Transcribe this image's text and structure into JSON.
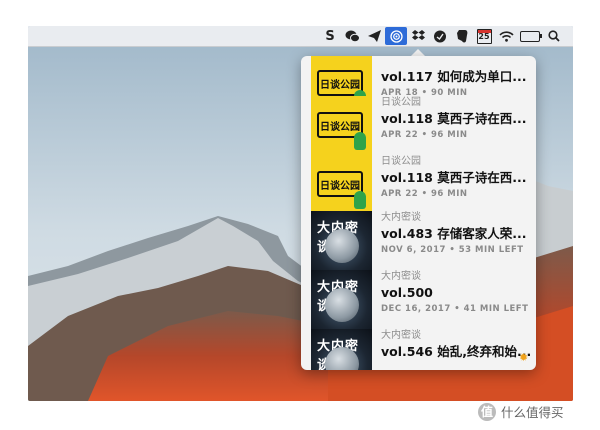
{
  "menubar": {
    "icons": [
      "s-icon",
      "wechat-icon",
      "telegram-icon",
      "podcast-icon",
      "dropbox-icon",
      "shield-icon",
      "evernote-icon",
      "calendar-icon",
      "wifi-icon",
      "battery-icon",
      "spotlight-icon"
    ],
    "s_glyph": "S",
    "calendar_day": "25"
  },
  "popup": {
    "episodes": [
      {
        "show": "",
        "title": "vol.117 如何成为单口...",
        "meta": "APR 18 • 90 MIN",
        "thumb": "yellow",
        "thumb_label": "日谈公园"
      },
      {
        "show": "日谈公园",
        "title": "vol.118 莫西子诗在西...",
        "meta": "APR 22 • 96 MIN",
        "thumb": "yellow",
        "thumb_label": "日谈公园"
      },
      {
        "show": "日谈公园",
        "title": "vol.118 莫西子诗在西...",
        "meta": "APR 22 • 96 MIN",
        "thumb": "yellow",
        "thumb_label": "日谈公园"
      },
      {
        "show": "大内密谈",
        "title": "vol.483 存储客家人荣...",
        "meta": "NOV 6, 2017 • 53 MIN LEFT",
        "thumb": "dark",
        "thumb_label": "大内密谈"
      },
      {
        "show": "大内密谈",
        "title": "vol.500",
        "meta": "DEC 16, 2017 • 41 MIN LEFT",
        "thumb": "dark",
        "thumb_label": "大内密谈"
      },
      {
        "show": "大内密谈",
        "title": "vol.546 始乱,终弃和始...",
        "meta": "",
        "thumb": "dark",
        "thumb_label": "大内密谈"
      }
    ]
  },
  "watermark": {
    "logo": "值",
    "text": "什么值得买"
  }
}
